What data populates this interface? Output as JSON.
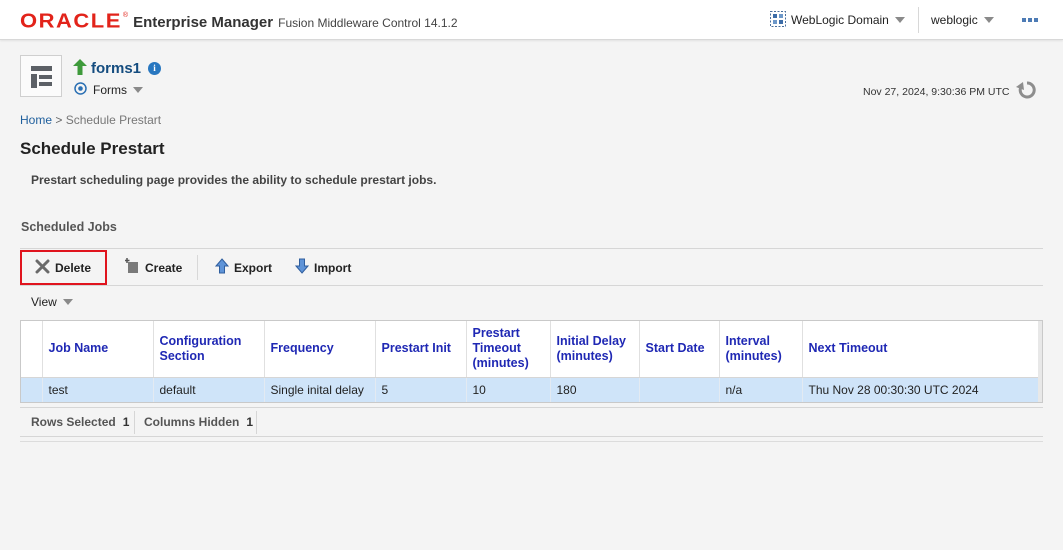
{
  "header": {
    "brand": "ORACLE",
    "product": "Enterprise Manager",
    "subtitle": "Fusion Middleware Control 14.1.2",
    "domain_menu_label": "WebLogic Domain",
    "user_menu_label": "weblogic"
  },
  "target": {
    "name": "forms1",
    "type": "Forms",
    "refresh_timestamp": "Nov 27, 2024, 9:30:36 PM UTC"
  },
  "breadcrumb": {
    "home": "Home",
    "separator": ">",
    "current": "Schedule Prestart"
  },
  "page": {
    "title": "Schedule Prestart",
    "description": "Prestart scheduling page provides the ability to schedule prestart jobs."
  },
  "section": {
    "title": "Scheduled Jobs"
  },
  "toolbar": {
    "delete_label": "Delete",
    "create_label": "Create",
    "export_label": "Export",
    "import_label": "Import"
  },
  "view_menu": {
    "label": "View"
  },
  "table": {
    "columns": [
      "Job Name",
      "Configuration Section",
      "Frequency",
      "Prestart Init",
      "Prestart Timeout (minutes)",
      "Initial Delay (minutes)",
      "Start Date",
      "Interval (minutes)",
      "Next Timeout"
    ],
    "rows": [
      [
        "test",
        "default",
        "Single inital delay",
        "5",
        "10",
        "180",
        "",
        "n/a",
        "Thu Nov 28 00:30:30 UTC 2024"
      ]
    ]
  },
  "status": {
    "rows_selected_label": "Rows Selected",
    "rows_selected_value": "1",
    "columns_hidden_label": "Columns Hidden",
    "columns_hidden_value": "1"
  },
  "colors": {
    "brand_red": "#e2231a",
    "link_blue": "#1f5f9d",
    "column_header_blue": "#1f28b4",
    "selected_row": "#cfe4f9",
    "highlight_border": "#e0141e"
  },
  "icons": [
    "target-navigation-icon",
    "up-status-icon",
    "info-icon",
    "forms-target-icon",
    "refresh-icon",
    "delete-x-icon",
    "create-icon",
    "export-arrow-icon",
    "import-arrow-icon",
    "weblogic-domain-icon"
  ]
}
